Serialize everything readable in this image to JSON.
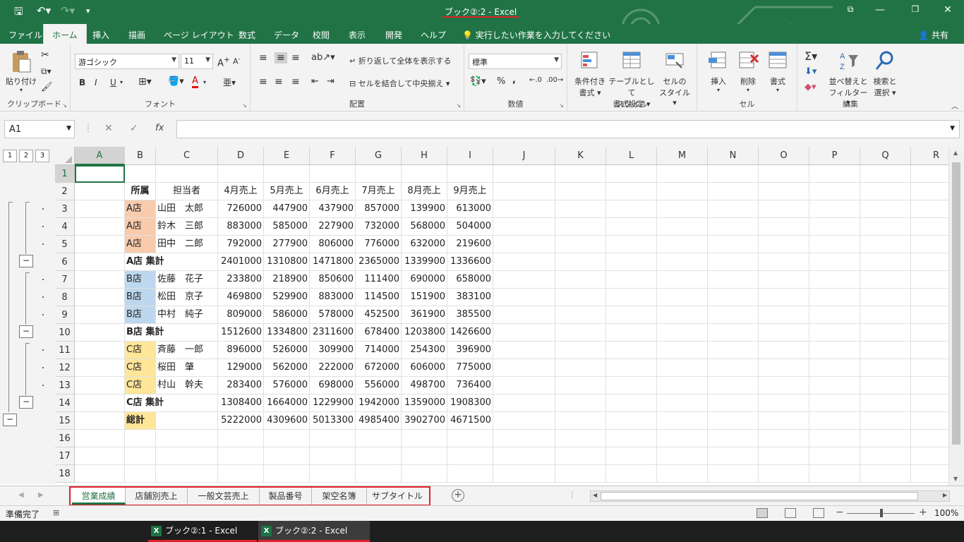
{
  "window": {
    "title": "ブック②:2  -  Excel",
    "share_label": "共有"
  },
  "ribbon_tabs": [
    "ファイル",
    "ホーム",
    "挿入",
    "描画",
    "ページ レイアウト",
    "数式",
    "データ",
    "校閲",
    "表示",
    "開発",
    "ヘルプ"
  ],
  "tell_me": "実行したい作業を入力してください",
  "ribbon": {
    "clipboard": {
      "paste": "貼り付け",
      "label": "クリップボード"
    },
    "font": {
      "name": "游ゴシック",
      "size": "11",
      "bold": "B",
      "italic": "I",
      "underline": "U",
      "label": "フォント"
    },
    "alignment": {
      "wrap": "折り返して全体を表示する",
      "merge": "セルを結合して中央揃え",
      "label": "配置"
    },
    "number": {
      "format": "標準",
      "percent": "%",
      "comma": ",",
      "label": "数値"
    },
    "styles": {
      "conditional_1": "条件付き",
      "conditional_2": "書式",
      "table_1": "テーブルとして",
      "table_2": "書式設定",
      "cell_1": "セルの",
      "cell_2": "スタイル",
      "label": "スタイル"
    },
    "cells": {
      "insert": "挿入",
      "delete": "削除",
      "format": "書式",
      "label": "セル"
    },
    "editing": {
      "sort_1": "並べ替えと",
      "sort_2": "フィルター",
      "find_1": "検索と",
      "find_2": "選択",
      "label": "編集"
    }
  },
  "formula_bar": {
    "name_box": "A1",
    "fx": "fx",
    "value": ""
  },
  "outline_levels": [
    "1",
    "2",
    "3"
  ],
  "columns": [
    "A",
    "B",
    "C",
    "D",
    "E",
    "F",
    "G",
    "H",
    "I",
    "J",
    "K",
    "L",
    "M",
    "N",
    "O",
    "P",
    "Q",
    "R"
  ],
  "row_numbers": [
    "1",
    "2",
    "3",
    "4",
    "5",
    "6",
    "7",
    "8",
    "9",
    "10",
    "11",
    "12",
    "13",
    "14",
    "15",
    "16",
    "17",
    "18"
  ],
  "table": {
    "header": [
      "所属",
      "担当者",
      "4月売上",
      "5月売上",
      "6月売上",
      "7月売上",
      "8月売上",
      "9月売上"
    ],
    "rows": [
      {
        "dept": "A店",
        "person": "山田　太郎",
        "values": [
          "726000",
          "447900",
          "437900",
          "857000",
          "139900",
          "613000"
        ],
        "kind": "A"
      },
      {
        "dept": "A店",
        "person": "鈴木　三郎",
        "values": [
          "883000",
          "585000",
          "227900",
          "732000",
          "568000",
          "504000"
        ],
        "kind": "A"
      },
      {
        "dept": "A店",
        "person": "田中　二郎",
        "values": [
          "792000",
          "277900",
          "806000",
          "776000",
          "632000",
          "219600"
        ],
        "kind": "A"
      },
      {
        "dept": "A店 集計",
        "person": "",
        "values": [
          "2401000",
          "1310800",
          "1471800",
          "2365000",
          "1339900",
          "1336600"
        ],
        "kind": "subtotal"
      },
      {
        "dept": "B店",
        "person": "佐藤　花子",
        "values": [
          "233800",
          "218900",
          "850600",
          "111400",
          "690000",
          "658000"
        ],
        "kind": "B"
      },
      {
        "dept": "B店",
        "person": "松田　京子",
        "values": [
          "469800",
          "529900",
          "883000",
          "114500",
          "151900",
          "383100"
        ],
        "kind": "B"
      },
      {
        "dept": "B店",
        "person": "中村　純子",
        "values": [
          "809000",
          "586000",
          "578000",
          "452500",
          "361900",
          "385500"
        ],
        "kind": "B"
      },
      {
        "dept": "B店 集計",
        "person": "",
        "values": [
          "1512600",
          "1334800",
          "2311600",
          "678400",
          "1203800",
          "1426600"
        ],
        "kind": "subtotal"
      },
      {
        "dept": "C店",
        "person": "斉藤　一郎",
        "values": [
          "896000",
          "526000",
          "309900",
          "714000",
          "254300",
          "396900"
        ],
        "kind": "C"
      },
      {
        "dept": "C店",
        "person": "桜田　肇",
        "values": [
          "129000",
          "562000",
          "222000",
          "672000",
          "606000",
          "775000"
        ],
        "kind": "C"
      },
      {
        "dept": "C店",
        "person": "村山　幹夫",
        "values": [
          "283400",
          "576000",
          "698000",
          "556000",
          "498700",
          "736400"
        ],
        "kind": "C"
      },
      {
        "dept": "C店 集計",
        "person": "",
        "values": [
          "1308400",
          "1664000",
          "1229900",
          "1942000",
          "1359000",
          "1908300"
        ],
        "kind": "subtotal"
      },
      {
        "dept": "総計",
        "person": "",
        "values": [
          "5222000",
          "4309600",
          "5013300",
          "4985400",
          "3902700",
          "4671500"
        ],
        "kind": "total"
      }
    ]
  },
  "sheet_tabs": [
    "営業成績",
    "店舗別売上",
    "一般文芸売上",
    "製品番号",
    "架空名簿",
    "サブタイトル"
  ],
  "status": {
    "ready": "準備完了",
    "zoom": "100%"
  },
  "taskbar": [
    "ブック②:1 - Excel",
    "ブック②:2 - Excel"
  ],
  "colors": {
    "excel_green": "#217346",
    "store_a": "#f8cbad",
    "store_b": "#bdd7ee",
    "store_c": "#ffe699",
    "highlight_red": "#e0232a"
  }
}
